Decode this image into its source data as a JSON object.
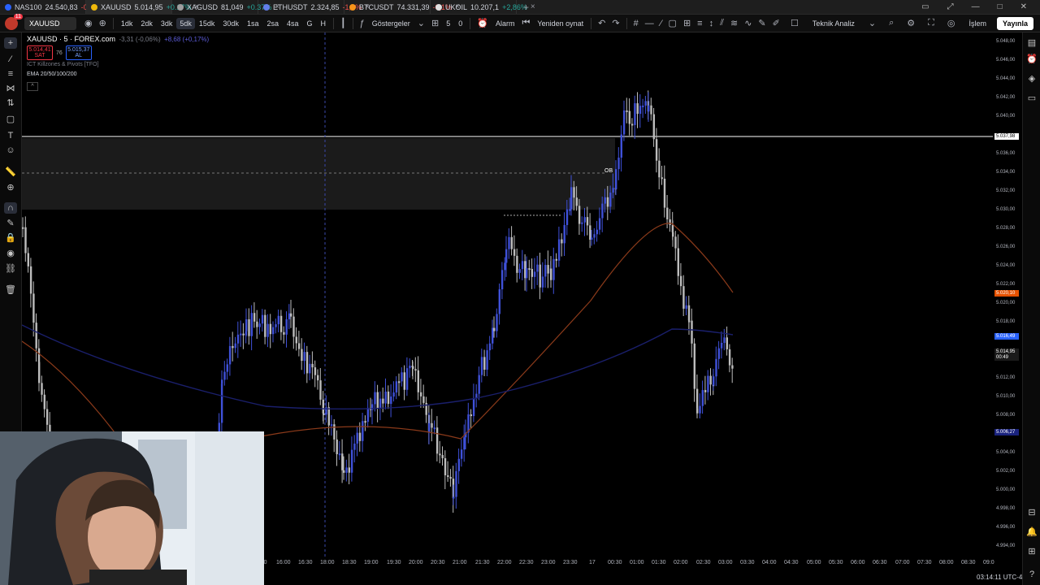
{
  "tabs": [
    {
      "symbol": "NAS100",
      "price": "24.540,83",
      "change": "-0,4%",
      "dir": "down",
      "color": "#2962ff"
    },
    {
      "symbol": "XAUUSD",
      "price": "5.014,95",
      "change": "+0.17%",
      "dir": "up",
      "color": "#f0b90b"
    },
    {
      "symbol": "XAGUSD",
      "price": "81,049",
      "change": "+0.37%",
      "dir": "up",
      "color": "#9e9e9e"
    },
    {
      "symbol": "ETHUSDT",
      "price": "2.324,85",
      "change": "-1,2%",
      "dir": "down",
      "color": "#627eea"
    },
    {
      "symbol": "BTCUSDT",
      "price": "74.331,39",
      "change": "-0,1%",
      "dir": "down",
      "color": "#f7931a"
    },
    {
      "symbol": "UKOIL",
      "price": "10.207,1",
      "change": "+2,86%",
      "dir": "up",
      "color": "#e0e0e0"
    }
  ],
  "toolbar": {
    "notifications": "11",
    "symbol": "XAUUSD",
    "intervals": [
      "1dk",
      "2dk",
      "3dk",
      "5dk",
      "15dk",
      "30dk",
      "1sa",
      "2sa",
      "4sa",
      "G",
      "H"
    ],
    "active_interval": "5dk",
    "indicators_label": "Göstergeler",
    "indicator_count_a": "5",
    "indicator_count_b": "0",
    "alarm_label": "Alarm",
    "replay_label": "Yeniden oynat",
    "analysis_label": "Teknik Analiz",
    "trade_label": "İşlem",
    "publish_label": "Yayınla"
  },
  "legend": {
    "title": "XAUUSD · 5 · FOREX.com",
    "change": "-3,31 (-0,06%)",
    "change2": "+8,68 (+0,17%)",
    "sell_price": "5.014,41",
    "sell_label": "SAT",
    "spread": "76",
    "buy_price": "5.015,37",
    "buy_label": "AL",
    "indicator1": "ICT Killzones & Pivots [TFO]",
    "indicator2": "EMA 20/50/100/200",
    "collapse_glyph": "^"
  },
  "chart": {
    "ob_label": "OB",
    "current_price": "5.014,95",
    "countdown": "00:49",
    "line_price": "5.037,98",
    "ema_price": "5.020,10",
    "blue_price1": "5.016,49",
    "blue_price2": "5.006,27",
    "y_ticks": [
      "5.048,00",
      "5.046,00",
      "5.044,00",
      "5.042,00",
      "5.040,00",
      "5.036,00",
      "5.034,00",
      "5.032,00",
      "5.030,00",
      "5.028,00",
      "5.026,00",
      "5.024,00",
      "5.022,00",
      "5.020,00",
      "5.018,00",
      "5.012,00",
      "5.010,00",
      "5.008,00",
      "5.004,00",
      "5.002,00",
      "5.000,00",
      "4.998,00",
      "4.996,00",
      "4.994,00"
    ],
    "x_ticks": [
      "15:30",
      "16:00",
      "16:30",
      "18:00",
      "18:30",
      "19:00",
      "19:30",
      "20:00",
      "20:30",
      "21:00",
      "21:30",
      "22:00",
      "22:30",
      "23:00",
      "23:30",
      "17",
      "00:30",
      "01:00",
      "01:30",
      "02:00",
      "02:30",
      "03:00",
      "03:30",
      "04:00",
      "04:30",
      "05:00",
      "05:30",
      "06:00",
      "06:30",
      "07:00",
      "07:30",
      "08:00",
      "08:30",
      "09:0"
    ],
    "status_time": "03:14:11 UTC-4"
  },
  "colors": {
    "bull": "#3f51d9",
    "bear": "#bdbdbd",
    "ema_slow": "#8b3a1a",
    "ema_fast": "#1a1f6b",
    "zone": "#2a2a2a"
  }
}
